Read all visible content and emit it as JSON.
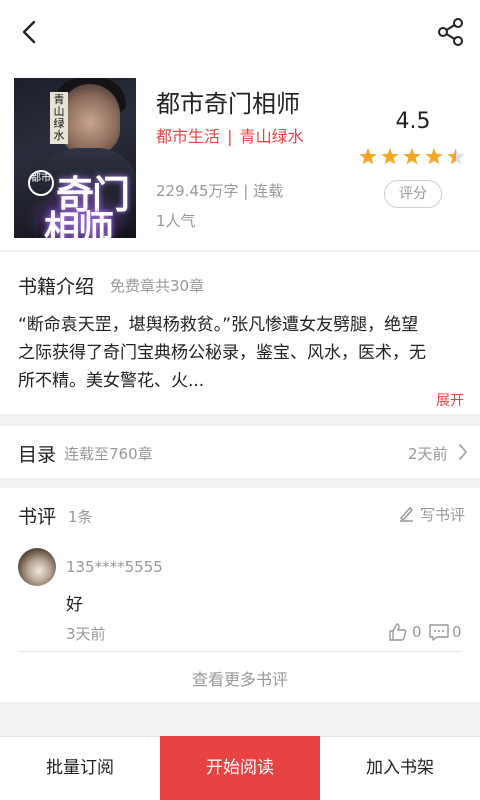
{
  "header": {
    "back_icon": "chevron-left-icon",
    "share_icon": "share-icon"
  },
  "book": {
    "title": "都市奇门相师",
    "category": "都市生活",
    "separator": "|",
    "author": "青山绿水",
    "words_status": "229.45万字 | 连载",
    "popularity": "1人气",
    "rating": "4.5",
    "rating_stars": 4.5,
    "rate_button": "评分",
    "cover": {
      "series_tag": "都市",
      "author_tag": "青山绿水",
      "title_line1": "奇门",
      "title_line2": "相师"
    }
  },
  "intro": {
    "heading": "书籍介绍",
    "free_chapters": "免费章共30章",
    "line1": "“断命袁天罡，堪舆杨救贫。”张凡惨遭女友劈腿，绝望",
    "line2": "之际获得了奇门宝典杨公秘录，鉴宝、风水，医术，无",
    "line3": "所不精。美女警花、火...",
    "expand": "展开"
  },
  "toc": {
    "heading": "目录",
    "status": "连载至760章",
    "updated": "2天前"
  },
  "reviews": {
    "heading": "书评",
    "count": "1条",
    "write_label": "写书评",
    "items": [
      {
        "user": "135****5555",
        "content": "好",
        "time": "3天前",
        "likes": "0",
        "comments": "0"
      }
    ],
    "more": "查看更多书评"
  },
  "bottom_bar": {
    "batch": "批量订阅",
    "read": "开始阅读",
    "shelf": "加入书架"
  },
  "colors": {
    "accent": "#e84343",
    "star": "#f5a623",
    "muted": "#999999"
  }
}
